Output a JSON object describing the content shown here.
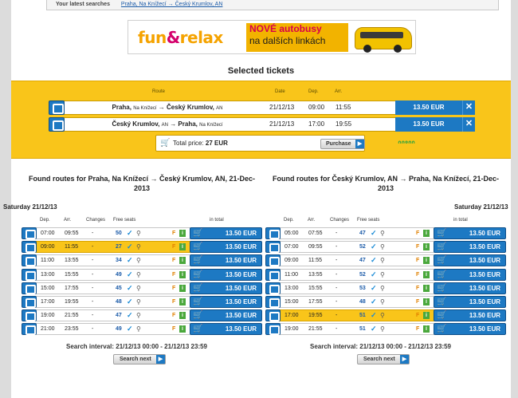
{
  "latest": {
    "label": "Your latest searches",
    "link": "Praha, Na Knížecí → Český Krumlov, AN"
  },
  "banner": {
    "logo_a": "fun",
    "logo_amp": "&",
    "logo_b": "relax",
    "line1": "NOVÉ autobusy",
    "line2": "na dalších linkách"
  },
  "selected": {
    "title": "Selected tickets",
    "headers": {
      "route": "Route",
      "date": "Date",
      "dep": "Dep.",
      "arr": "Arr."
    },
    "rows": [
      {
        "from": "Praha,",
        "from_sm": "Na Knížecí",
        "arrow": "→",
        "to": "Český Krumlov,",
        "to_sm": "AN",
        "date": "21/12/13",
        "dep": "09:00",
        "arr": "11:55",
        "price": "13.50 EUR",
        "remove": "✕"
      },
      {
        "from": "Český Krumlov,",
        "from_sm": "AN",
        "arrow": "→",
        "to": "Praha,",
        "to_sm": "Na Knížecí",
        "date": "21/12/13",
        "dep": "17:00",
        "arr": "19:55",
        "price": "13.50 EUR",
        "remove": "✕"
      }
    ],
    "total_label": "Total price:",
    "total_value": "27 EUR",
    "purchase": "Purchase",
    "stamp": "ᐢᐢᐤᐢᐢ"
  },
  "columns": [
    {
      "title": "Found routes for Praha, Na Knížecí → Český Krumlov, AN, 21-Dec-2013",
      "day": "Saturday 21/12/13",
      "headers": {
        "dep": "Dep.",
        "arr": "Arr.",
        "changes": "Changes",
        "seats": "Free seats",
        "total": "in total"
      },
      "rows": [
        {
          "dep": "07:00",
          "arr": "09:55",
          "changes": "-",
          "seats": "50",
          "price": "13.50 EUR",
          "hl": false
        },
        {
          "dep": "09:00",
          "arr": "11:55",
          "changes": "-",
          "seats": "27",
          "price": "13.50 EUR",
          "hl": true
        },
        {
          "dep": "11:00",
          "arr": "13:55",
          "changes": "-",
          "seats": "34",
          "price": "13.50 EUR",
          "hl": false
        },
        {
          "dep": "13:00",
          "arr": "15:55",
          "changes": "-",
          "seats": "49",
          "price": "13.50 EUR",
          "hl": false
        },
        {
          "dep": "15:00",
          "arr": "17:55",
          "changes": "-",
          "seats": "45",
          "price": "13.50 EUR",
          "hl": false
        },
        {
          "dep": "17:00",
          "arr": "19:55",
          "changes": "-",
          "seats": "48",
          "price": "13.50 EUR",
          "hl": false
        },
        {
          "dep": "19:00",
          "arr": "21:55",
          "changes": "-",
          "seats": "47",
          "price": "13.50 EUR",
          "hl": false
        },
        {
          "dep": "21:00",
          "arr": "23:55",
          "changes": "-",
          "seats": "49",
          "price": "13.50 EUR",
          "hl": false
        }
      ],
      "interval": "Search interval: 21/12/13 00:00 - 21/12/13 23:59",
      "next": "Search next"
    },
    {
      "title": "Found routes for Český Krumlov, AN → Praha, Na Knížecí, 21-Dec-2013",
      "day": "Saturday 21/12/13",
      "headers": {
        "dep": "Dep.",
        "arr": "Arr.",
        "changes": "Changes",
        "seats": "Free seats",
        "total": "in total"
      },
      "rows": [
        {
          "dep": "05:00",
          "arr": "07:55",
          "changes": "-",
          "seats": "47",
          "price": "13.50 EUR",
          "hl": false
        },
        {
          "dep": "07:00",
          "arr": "09:55",
          "changes": "-",
          "seats": "52",
          "price": "13.50 EUR",
          "hl": false
        },
        {
          "dep": "09:00",
          "arr": "11:55",
          "changes": "-",
          "seats": "47",
          "price": "13.50 EUR",
          "hl": false
        },
        {
          "dep": "11:00",
          "arr": "13:55",
          "changes": "-",
          "seats": "52",
          "price": "13.50 EUR",
          "hl": false
        },
        {
          "dep": "13:00",
          "arr": "15:55",
          "changes": "-",
          "seats": "53",
          "price": "13.50 EUR",
          "hl": false
        },
        {
          "dep": "15:00",
          "arr": "17:55",
          "changes": "-",
          "seats": "48",
          "price": "13.50 EUR",
          "hl": false
        },
        {
          "dep": "17:00",
          "arr": "19:55",
          "changes": "-",
          "seats": "51",
          "price": "13.50 EUR",
          "hl": true
        },
        {
          "dep": "19:00",
          "arr": "21:55",
          "changes": "-",
          "seats": "51",
          "price": "13.50 EUR",
          "hl": false
        }
      ],
      "interval": "Search interval: 21/12/13 00:00 - 21/12/13 23:59",
      "next": "Search next"
    }
  ],
  "colors": {
    "accent_blue": "#1d79c3",
    "highlight_yellow": "#f9c51a"
  },
  "icons": [
    "bus-icon",
    "cart-icon",
    "check-icon",
    "magnifier-icon",
    "facility-f-icon",
    "info-icon",
    "close-icon",
    "arrow-right-icon"
  ]
}
